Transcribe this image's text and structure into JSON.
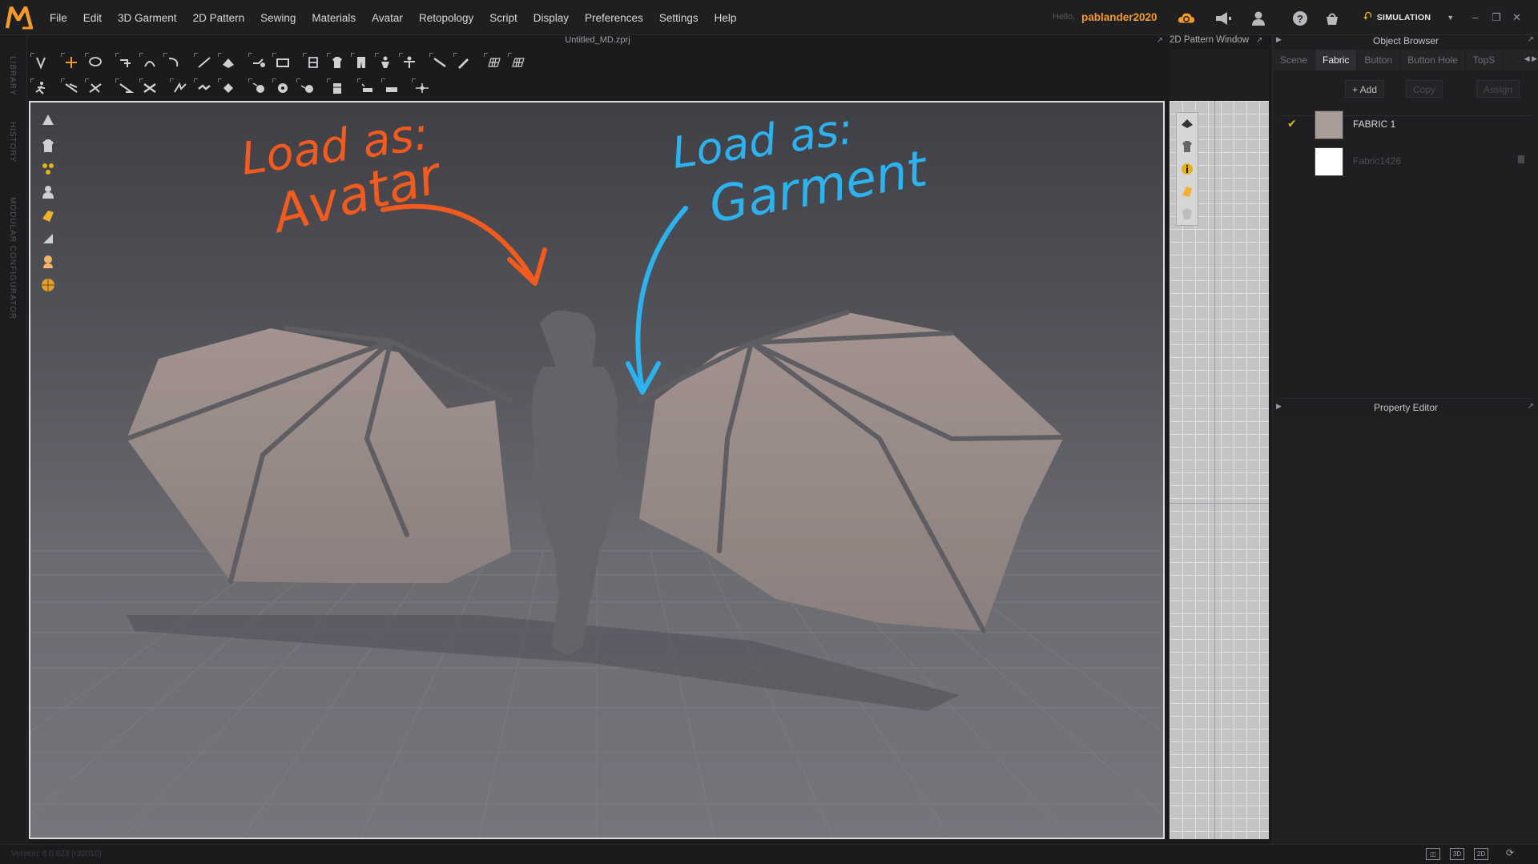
{
  "app": {
    "menus": [
      "File",
      "Edit",
      "3D Garment",
      "2D Pattern",
      "Sewing",
      "Materials",
      "Avatar",
      "Retopology",
      "Script",
      "Display",
      "Preferences",
      "Settings",
      "Help"
    ],
    "hello": "Hello,",
    "username": "pablander2020",
    "mode_label": "SIMULATION",
    "accent_color": "#f29a2e",
    "mode_color": "#e2b316"
  },
  "left_tabs": [
    "LIBRARY",
    "HISTORY",
    "MODULAR CONFIGURATOR"
  ],
  "viewport": {
    "title": "Untitled_MD.zprj",
    "annotation_avatar_line1": "Load as:",
    "annotation_avatar_line2": "Avatar",
    "annotation_garment_line1": "Load as:",
    "annotation_garment_line2": "Garment",
    "avatar_annotation_color": "#f25a1e",
    "garment_annotation_color": "#2cb2ee"
  },
  "pattern_window": {
    "title": "2D Pattern Window"
  },
  "object_browser": {
    "title": "Object Browser",
    "tabs": [
      "Scene",
      "Fabric",
      "Button",
      "Button Hole",
      "TopS"
    ],
    "active_tab": "Fabric",
    "add_label": "+ Add",
    "copy_label": "Copy",
    "assign_label": "Assign",
    "fabrics": [
      {
        "name": "FABRIC 1",
        "swatch": "#a99d99",
        "checked": true
      },
      {
        "name": "Fabric1426",
        "swatch": "#ffffff",
        "checked": false
      }
    ]
  },
  "property_editor": {
    "title": "Property Editor"
  },
  "status": {
    "version": "Version: 6.0.623 (r33010)"
  }
}
